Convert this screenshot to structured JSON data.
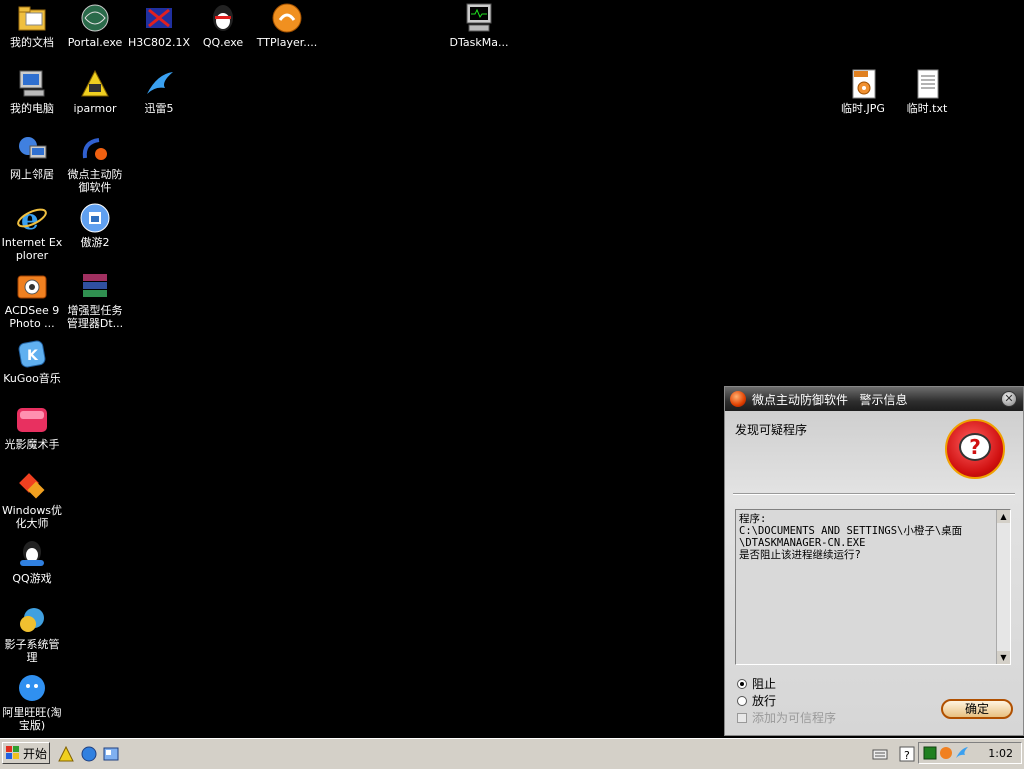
{
  "desktop": {
    "icons": [
      {
        "label": "我的文档",
        "icon": "folder-icon"
      },
      {
        "label": "Portal.exe",
        "icon": "globe-icon"
      },
      {
        "label": "H3C802.1X",
        "icon": "h3c-icon"
      },
      {
        "label": "QQ.exe",
        "icon": "qq-penguin-icon"
      },
      {
        "label": "TTPlayer....",
        "icon": "ttplayer-icon"
      },
      {
        "label": "DTaskMa...",
        "icon": "computer-monitor-icon"
      },
      {
        "label": "我的电脑",
        "icon": "my-computer-icon"
      },
      {
        "label": "iparmor",
        "icon": "iparmor-icon"
      },
      {
        "label": "迅雷5",
        "icon": "xunlei-bird-icon"
      },
      {
        "label": "临时.JPG",
        "icon": "jpg-file-icon"
      },
      {
        "label": "临时.txt",
        "icon": "txt-file-icon"
      },
      {
        "label": "网上邻居",
        "icon": "network-icon"
      },
      {
        "label": "微点主动防御软件",
        "icon": "micropoint-icon"
      },
      {
        "label": "Internet Explorer",
        "icon": "ie-icon"
      },
      {
        "label": "傲游2",
        "icon": "maxthon-icon"
      },
      {
        "label": "ACDSee 9 Photo ...",
        "icon": "camera-icon"
      },
      {
        "label": "增强型任务管理器Dt...",
        "icon": "winrar-books-icon"
      },
      {
        "label": "KuGoo音乐",
        "icon": "kugoo-icon"
      },
      {
        "label": "光影魔术手",
        "icon": "photo-magic-icon"
      },
      {
        "label": "Windows优化大师",
        "icon": "windows-optimizer-icon"
      },
      {
        "label": "QQ游戏",
        "icon": "qq-game-icon"
      },
      {
        "label": "影子系统管理",
        "icon": "shadow-system-icon"
      },
      {
        "label": "阿里旺旺(淘宝版)",
        "icon": "aliwangwang-icon"
      }
    ]
  },
  "taskbar": {
    "start_label": "开始",
    "clock": "1:02"
  },
  "dialog": {
    "title": "微点主动防御软件   警示信息",
    "heading": "发现可疑程序",
    "message": "程序:\nC:\\DOCUMENTS AND SETTINGS\\小橙子\\桌面\n\\DTASKMANAGER-CN.EXE\n是否阻止该进程继续运行?",
    "option_block": "阻止",
    "option_allow": "放行",
    "option_trust": "添加为可信程序",
    "ok_label": "确定"
  },
  "colors": {
    "desktop_bg": "#000000",
    "taskbar_bg": "#d4d0c8",
    "dialog_title_bg": "#2e2e2e",
    "ok_button_border": "#b05000"
  }
}
